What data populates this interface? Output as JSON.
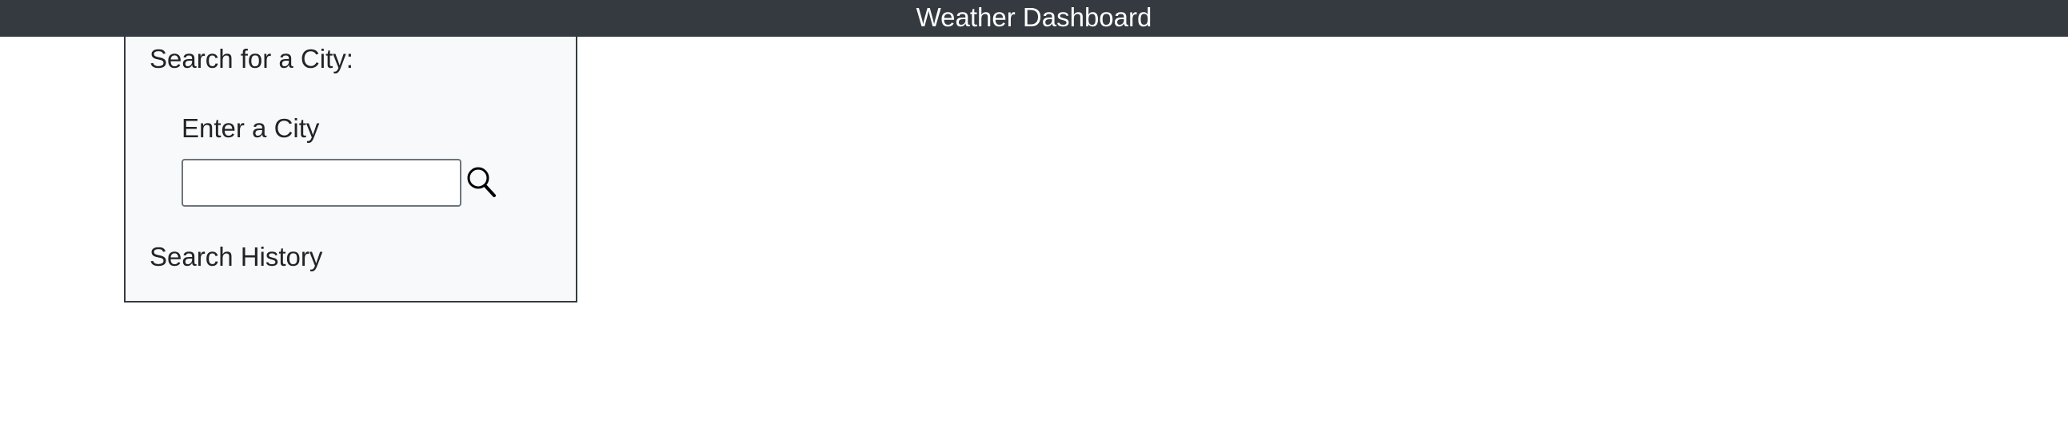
{
  "header": {
    "title": "Weather Dashboard"
  },
  "search_panel": {
    "heading": "Search for a City:",
    "field_label": "Enter a City",
    "input_value": "",
    "input_placeholder": "",
    "search_icon": "search-icon",
    "history_heading": "Search History"
  },
  "colors": {
    "header_bg": "#343a40",
    "header_text": "#ffffff",
    "panel_bg": "#f8f9fa",
    "panel_border": "#343a40"
  }
}
